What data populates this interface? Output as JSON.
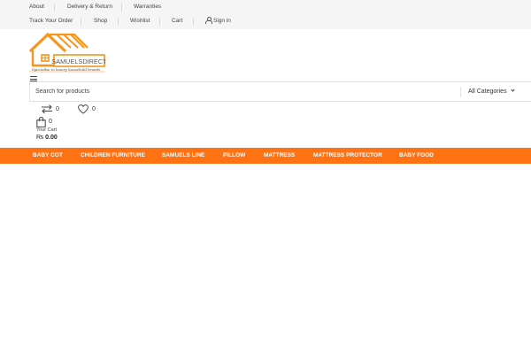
{
  "topbar": {
    "row1": [
      "About",
      "Delivery & Return",
      "Warranties"
    ],
    "row2": [
      "Track Your Order",
      "Shop",
      "Wishlist",
      "Cart"
    ],
    "sign_in": "Sign in"
  },
  "logo": {
    "name": "SAMUELSDIRECT",
    "tagline": "Specialise in luxury household brands",
    "color": "#f7941d"
  },
  "search": {
    "placeholder": "Search for products",
    "category": "All Categories"
  },
  "header_icons": {
    "compare_count": "0",
    "wishlist_count": "0",
    "cart_count": "0",
    "cart_label": "Your Cart",
    "cart_currency": "₨",
    "cart_total": "0.00"
  },
  "nav": {
    "color": "#ff7214",
    "items": [
      "BABY COT",
      "CHILDREN FURNITURE",
      "SAMUELS LINE",
      "PILLOW",
      "MATTRESS",
      "MATTRESS PROTECTOR",
      "BABY FOOD"
    ]
  }
}
